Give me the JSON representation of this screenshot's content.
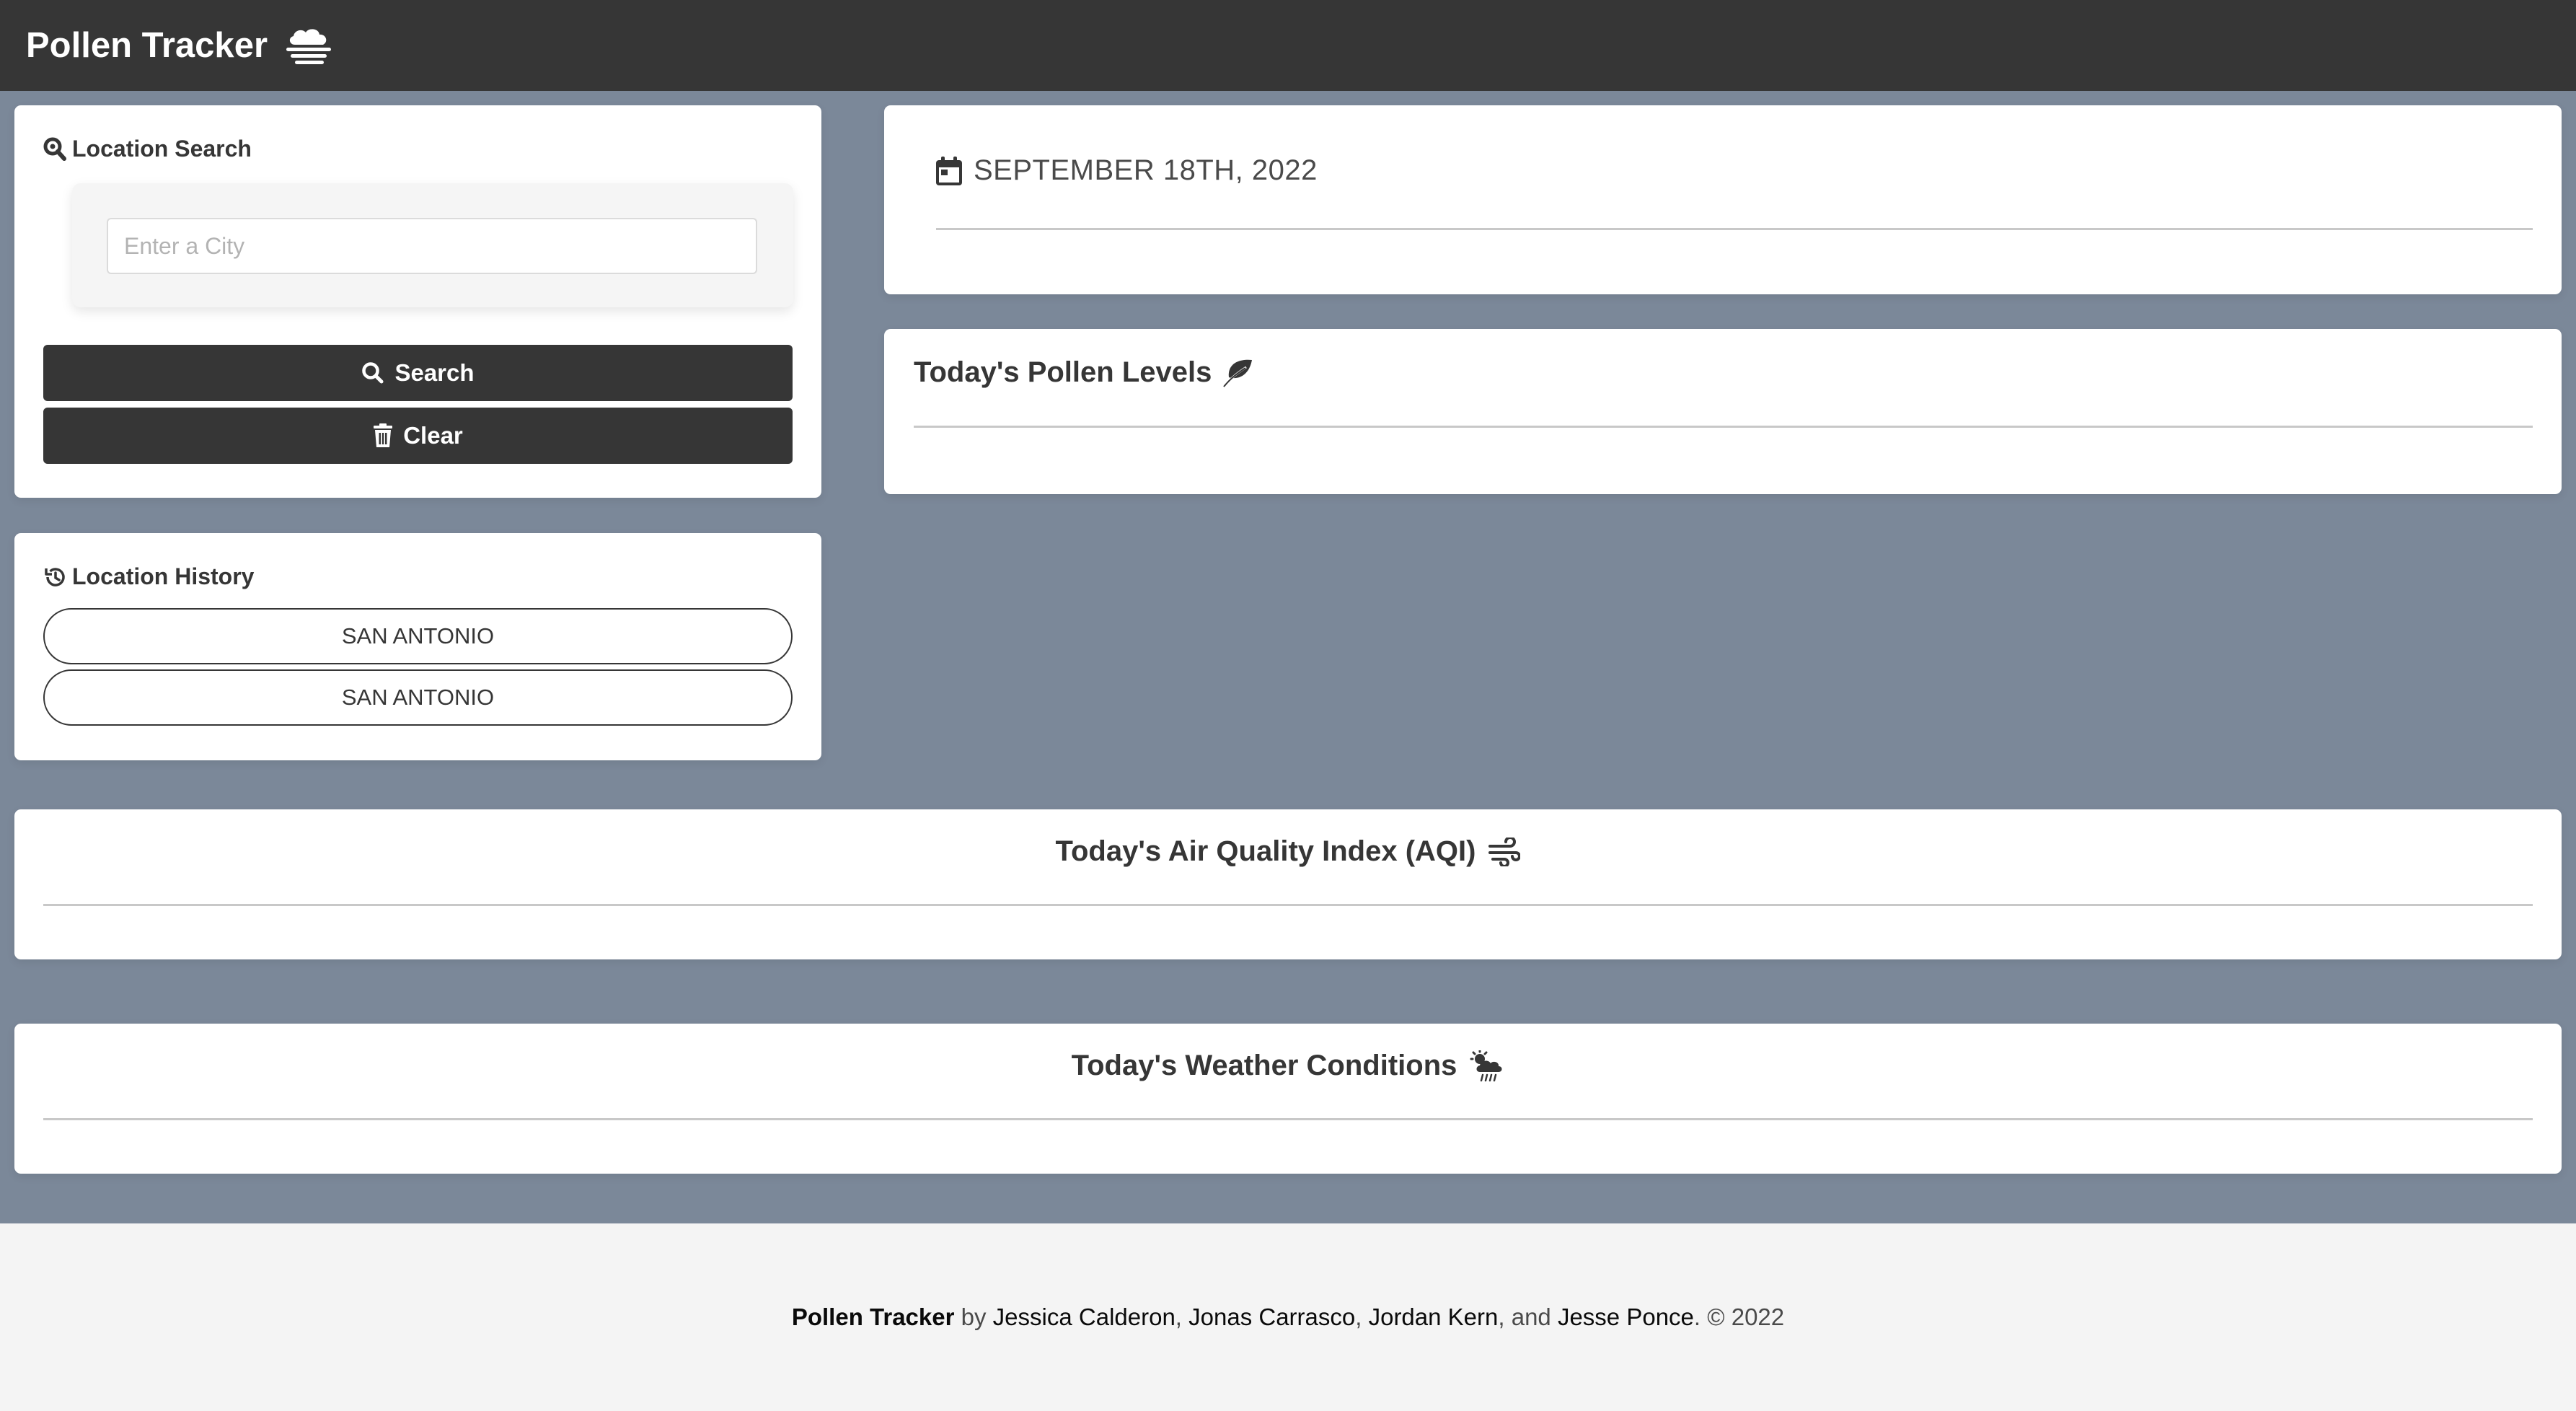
{
  "app": {
    "title": "Pollen Tracker",
    "brand_icon": "cloud-fog-icon"
  },
  "search_card": {
    "heading": "Location Search",
    "input_placeholder": "Enter a City",
    "input_value": "",
    "search_label": "Search",
    "clear_label": "Clear"
  },
  "history_card": {
    "heading": "Location History",
    "items": [
      "SAN ANTONIO",
      "SAN ANTONIO"
    ]
  },
  "date_card": {
    "date": "SEPTEMBER 18TH, 2022"
  },
  "pollen_card": {
    "heading": "Today's Pollen Levels"
  },
  "aqi_card": {
    "heading": "Today's Air Quality Index (AQI)"
  },
  "weather_card": {
    "heading": "Today's Weather Conditions"
  },
  "footer": {
    "app_name": "Pollen Tracker",
    "by": "by",
    "authors": [
      "Jessica Calderon",
      "Jonas Carrasco",
      "Jordan Kern",
      "Jesse Ponce"
    ],
    "sep1": ",",
    "sep2": ",",
    "sep3": ", and",
    "copyright": ". © 2022"
  },
  "colors": {
    "navbar": "#363636",
    "page_background": "#7b8899",
    "footer_background": "#f4f4f4",
    "card": "#ffffff"
  }
}
